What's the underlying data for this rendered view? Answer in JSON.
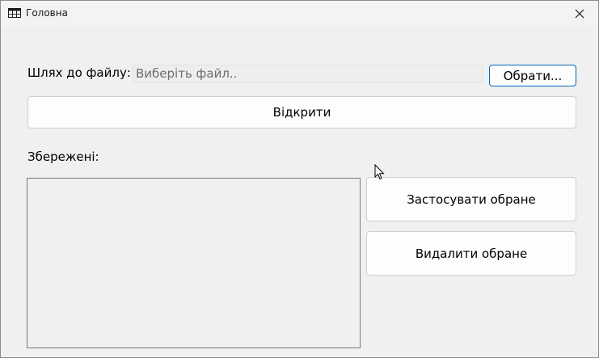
{
  "window": {
    "title": "Головна"
  },
  "form": {
    "path_label": "Шлях до файлу:",
    "path_placeholder": "Виберіть файл..",
    "path_value": "",
    "browse_label": "Обрати...",
    "open_label": "Відкрити",
    "saved_label": "Збережені:",
    "apply_label": "Застосувати обране",
    "delete_label": "Видалити обране",
    "saved_items": []
  },
  "icons": {
    "app": "table-app-icon",
    "close": "close-icon",
    "cursor": "mouse-cursor-icon"
  }
}
